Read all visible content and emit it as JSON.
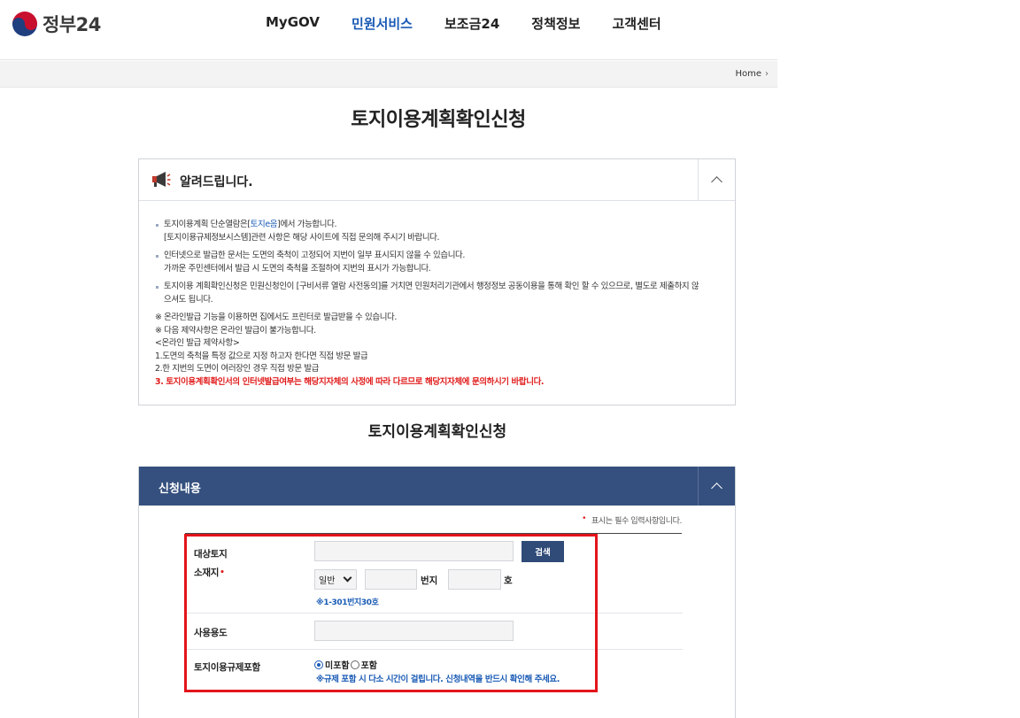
{
  "header": {
    "logo_text": "정부24",
    "nav": [
      {
        "label": "MyGOV",
        "active": false
      },
      {
        "label": "민원서비스",
        "active": true
      },
      {
        "label": "보조금24",
        "active": false
      },
      {
        "label": "정책정보",
        "active": false
      },
      {
        "label": "고객센터",
        "active": false
      }
    ]
  },
  "breadcrumb": {
    "home": "Home",
    "arrow": "›"
  },
  "page": {
    "title": "토지이용계획확인신청"
  },
  "notice": {
    "title": "알려드립니다.",
    "bullets": [
      {
        "line1_pre": "토지이용계획 단순열람은[",
        "line1_link": "토지e음",
        "line1_post": "]에서 가능합니다.",
        "line2": "[토지이용규제정보시스템]관련 사항은 해당 사이트에 직접 문의해 주시기 바랍니다."
      },
      {
        "line1": "인터넷으로 발급한 문서는 도면의 축척이 고정되어 지번이 일부 표시되지 않을 수 있습니다.",
        "line2": "가까운 주민센터에서 발급 시 도면의 축척을 조절하여 지번의 표시가 가능합니다."
      },
      {
        "line1": "토지이용 계획확인신청은 민원신청인이 [구비서류 열람 사전동의]를 거치면 민원처리기관에서 행정정보 공동이용을 통해 확인 할 수 있으므로, 별도로 제출하지 않",
        "line2": "으셔도 됩니다."
      }
    ],
    "notes": [
      "※ 온라인발급 기능을 이용하면 집에서도 프린터로 발급받을 수 있습니다.",
      "※ 다음 제약사항은 온라인 발급이 불가능합니다.",
      "<온라인 발급 제약사항>",
      "1.도면의 축척을 특정 값으로 지정 하고자 한다면 직접 방문 발급",
      "2.한 지번의 도면이 여러장인 경우 직접 방문 발급"
    ],
    "warning": "3. 토지이용계획확인서의 인터넷발급여부는 해당지자체의 사정에 따라 다르므로 해당지자체에 문의하시기 바랍니다."
  },
  "section": {
    "title": "토지이용계획확인신청"
  },
  "panel": {
    "title": "신청내용",
    "required_note": "표시는 필수 입력사항입니다.",
    "required_mark": "•"
  },
  "form": {
    "land": {
      "label_line1": "대상토지",
      "label_line2": "소재지",
      "required_mark": "•",
      "address_value": "",
      "search_button": "검색",
      "type_select": "일반",
      "lot_main_value": "",
      "lot_main_unit": "번지",
      "lot_sub_value": "",
      "lot_sub_unit": "호",
      "hint": "※1-301번지30호"
    },
    "usage": {
      "label": "사용용도",
      "value": ""
    },
    "regulation": {
      "label": "토지이용규제포함",
      "options": [
        {
          "label": "미포함",
          "selected": true
        },
        {
          "label": "포함",
          "selected": false
        }
      ],
      "hint": "※규제 포함 시 다소 시간이 걸립니다. 신청내역을 반드시 확인해 주세요."
    }
  },
  "colors": {
    "brand_blue": "#1a5bb5",
    "panel_navy": "#35507e",
    "button_navy": "#304b78",
    "warning_red": "#e11c1c",
    "highlight_red": "#e3141b"
  }
}
